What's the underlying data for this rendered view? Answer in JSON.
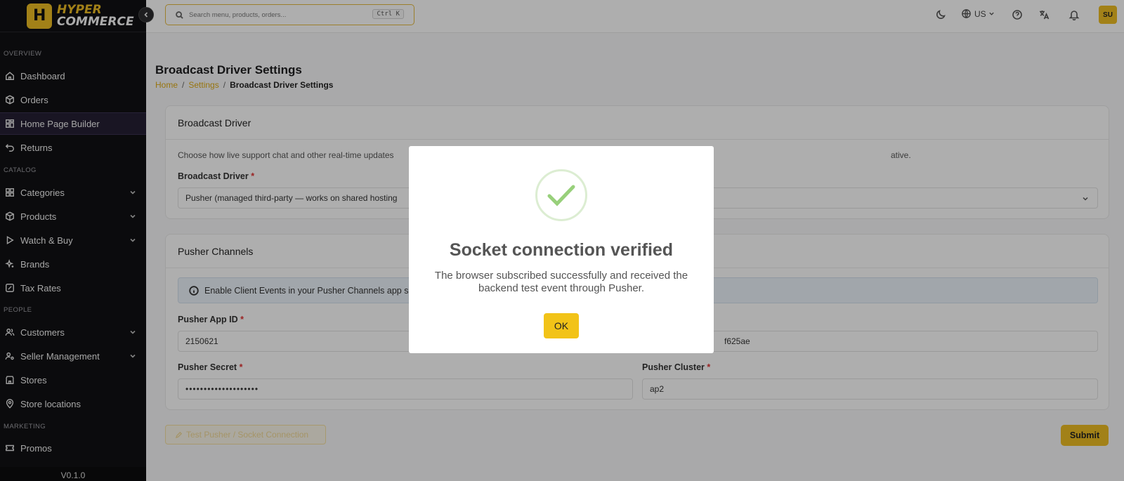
{
  "brand": {
    "line1": "HYPER",
    "line2": "COMMERCE"
  },
  "sidebar": {
    "sections": {
      "overview": "OVERVIEW",
      "catalog": "CATALOG",
      "people": "PEOPLE",
      "marketing": "MARKETING"
    },
    "items": {
      "dashboard": "Dashboard",
      "orders": "Orders",
      "home_page_builder": "Home Page Builder",
      "returns": "Returns",
      "categories": "Categories",
      "products": "Products",
      "watch_buy": "Watch & Buy",
      "brands": "Brands",
      "tax_rates": "Tax Rates",
      "customers": "Customers",
      "seller_management": "Seller Management",
      "stores": "Stores",
      "store_locations": "Store locations",
      "promos": "Promos"
    },
    "version": "V0.1.0"
  },
  "header": {
    "search_placeholder": "Search menu, products, orders...",
    "search_shortcut": "Ctrl K",
    "language": "US",
    "avatar_initials": "SU"
  },
  "page": {
    "title": "Broadcast Driver Settings",
    "breadcrumb": {
      "home": "Home",
      "settings": "Settings",
      "current": "Broadcast Driver Settings"
    }
  },
  "broadcast_card": {
    "title": "Broadcast Driver",
    "description_left": "Choose how live support chat and other real-time updates",
    "description_right": "ative.",
    "driver_label": "Broadcast Driver",
    "driver_value": "Pusher (managed third-party — works on shared hosting"
  },
  "pusher_card": {
    "title": "Pusher Channels",
    "info_text": "Enable Client Events in your Pusher Channels app se",
    "app_id_label": "Pusher App ID",
    "app_id_value": "2150621",
    "key_value_visible": "f625ae",
    "secret_label": "Pusher Secret",
    "secret_value": "••••••••••••••••••••",
    "cluster_label": "Pusher Cluster",
    "cluster_value": "ap2"
  },
  "actions": {
    "test_label": "Test Pusher / Socket Connection",
    "submit_label": "Submit"
  },
  "modal": {
    "title": "Socket connection verified",
    "text": "The browser subscribed successfully and received the backend test event through Pusher.",
    "ok_label": "OK"
  },
  "colors": {
    "accent": "#e8b923",
    "sidebar_bg": "#111113",
    "success": "#98d07b"
  }
}
